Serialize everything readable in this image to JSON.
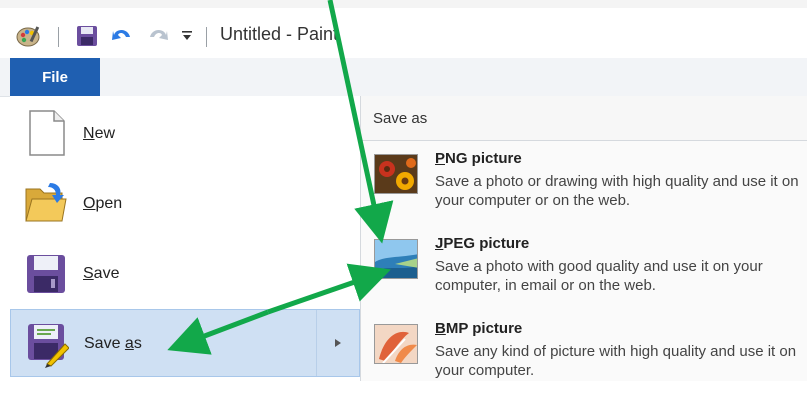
{
  "window": {
    "title": "Untitled - Paint"
  },
  "ribbon": {
    "file_tab": "File"
  },
  "file_menu": {
    "items": [
      {
        "label": "New",
        "mnemonic": "N",
        "rest": "ew",
        "icon": "new-document-icon"
      },
      {
        "label": "Open",
        "mnemonic": "O",
        "rest": "pen",
        "icon": "open-folder-icon"
      },
      {
        "label": "Save",
        "mnemonic": "S",
        "rest": "ave",
        "icon": "save-icon"
      },
      {
        "label": "Save as",
        "prefix": "Save ",
        "mnemonic": "a",
        "rest": "s",
        "icon": "save-as-icon",
        "active": true
      }
    ]
  },
  "save_as_panel": {
    "header": "Save as",
    "options": [
      {
        "title_mnemonic": "P",
        "title_rest": "NG picture",
        "description": "Save a photo or drawing with high quality and use it on your computer or on the web.",
        "icon": "png-picture-icon"
      },
      {
        "title_mnemonic": "J",
        "title_rest": "PEG picture",
        "description": "Save a photo with good quality and use it on your computer, in email or on the web.",
        "icon": "jpeg-picture-icon"
      },
      {
        "title_mnemonic": "B",
        "title_rest": "MP picture",
        "description": "Save any kind of picture with high quality and use it on your computer.",
        "icon": "bmp-picture-icon"
      }
    ]
  },
  "colors": {
    "file_tab": "#1f5fb1",
    "active_item": "#cfe0f3",
    "annotation_arrow": "#12a84a"
  }
}
